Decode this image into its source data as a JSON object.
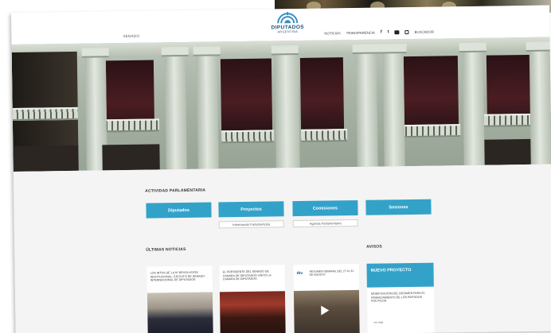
{
  "header": {
    "left_link": "SENADO",
    "logo_title": "DIPUTADOS",
    "logo_subtitle": "ARGENTINA",
    "nav": [
      "NOTICIAS",
      "TRANSPARENCIA"
    ],
    "social_f": "f",
    "social_t": "t",
    "search": "BUSCADOR"
  },
  "actividad": {
    "title": "ACTIVIDAD PARLAMENTARIA",
    "buttons": [
      "Diputados",
      "Proyectos",
      "Comisiones",
      "Sesiones"
    ],
    "sub_links": [
      "Información Parlamentaria",
      "Agenda Parlamentaria"
    ]
  },
  "noticias": {
    "title": "ÚLTIMAS NOTICIAS",
    "cards": [
      {
        "text": "LOS INTOS DE LA Nº REVOLUCIÓN INSTITUCIONAL, EJECUTÓ DE SENADO INTERNACIONAL DE DIPUTADOS"
      },
      {
        "text": "EL PRESIDENTE DEL SENADO DE CAMARA DE DIPUTADOS VISITÓ LA CAMARA DE DIPUTADOS"
      },
      {
        "logo": "dtv",
        "text": "RESUMEN SEMANAL DEL 27 AL 31 DE AGOSTO"
      }
    ]
  },
  "avisos": {
    "title": "AVISOS",
    "head": "NUEVO PROYECTO",
    "text": "MODIFICACIÓN DEL RÉGIMEN PARA EL FINANCIAMIENTO DE LOS PARTIDOS POLÍTICOS",
    "more": "ver más"
  },
  "colors": {
    "accent": "#33a2c9",
    "brand": "#1f4f7a"
  }
}
